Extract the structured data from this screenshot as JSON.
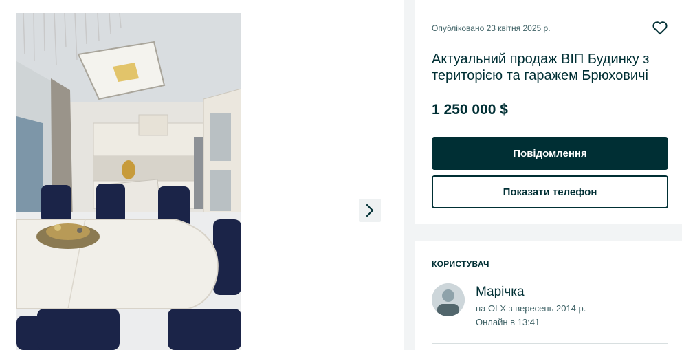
{
  "gallery": {
    "photo_alt": "",
    "next_icon": "chevron-right-icon"
  },
  "listing": {
    "published": "Опубліковано 23 квітня 2025 р.",
    "favorite_icon": "heart-outline-icon",
    "title": "Актуальний продаж ВІП Будинку з територією та гаражем Брюховичі",
    "price": "1 250 000 $",
    "message_button": "Повідомлення",
    "phone_button": "Показати телефон"
  },
  "user": {
    "section_title": "КОРИСТУВАЧ",
    "name": "Марічка",
    "since": "на OLX з вересень 2014 р.",
    "online": "Онлайн в 13:41",
    "avatar_icon": "user-avatar-icon"
  },
  "colors": {
    "primary": "#002f34",
    "background": "#f2f4f5",
    "muted_text": "#406367"
  }
}
